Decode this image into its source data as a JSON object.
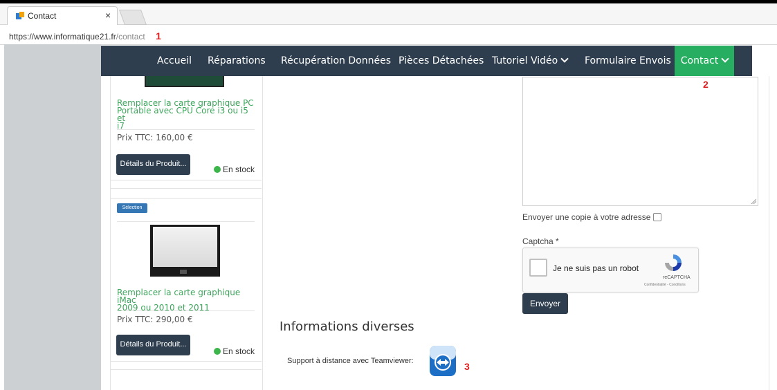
{
  "browser": {
    "tab_title": "Contact",
    "tab_close": "×",
    "url_proto": "https://www.informatique21.fr",
    "url_path": "/contact",
    "markers": [
      "1",
      "2",
      "3"
    ]
  },
  "nav": {
    "items": [
      "Accueil",
      "Réparations",
      "Récupération Données",
      "Pièces Détachées",
      "Tutoriel Vidéo",
      "Formulaire Envois",
      "Contact"
    ]
  },
  "products": [
    {
      "title_lines": [
        "Remplacer la carte graphique PC",
        "Portable avec CPU Core i3 ou i5 et",
        "i7"
      ],
      "price": "Prix TTC: 160,00 €",
      "button": "Détails du Produit...",
      "stock": "En stock"
    },
    {
      "badge": "Sélection",
      "title_lines": [
        "Remplacer la carte graphique iMac",
        "2009 ou 2010 et 2011"
      ],
      "price": "Prix TTC: 290,00 €",
      "button": "Détails du Produit...",
      "stock": "En stock"
    }
  ],
  "form": {
    "copy_label": "Envoyer une copie à votre adresse",
    "captcha_label": "Captcha *",
    "recaptcha_text": "Je ne suis pas un robot",
    "recaptcha_brand": "reCAPTCHA",
    "recaptcha_links": "Confidentialité - Conditions",
    "submit": "Envoyer"
  },
  "info": {
    "heading": "Informations diverses",
    "teamviewer_text": "Support à distance avec Teamviewer:"
  },
  "colors": {
    "nav_bg": "#2e3e4e",
    "nav_active": "#27ae60",
    "product_title": "#3ea55c",
    "badge": "#3577b5",
    "marker": "#e02020"
  }
}
